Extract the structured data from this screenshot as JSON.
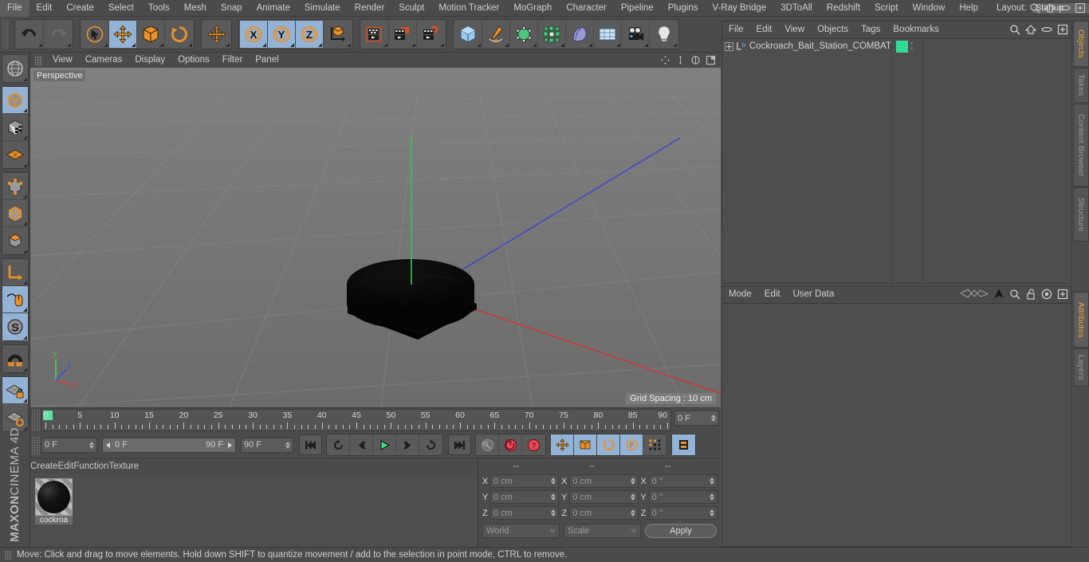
{
  "app": {
    "name": "MAXON CINEMA 4D",
    "brand_bold": "MAXON",
    "brand_rest": "CINEMA 4D"
  },
  "menubar": {
    "items": [
      {
        "label": "File"
      },
      {
        "label": "Edit"
      },
      {
        "label": "Create"
      },
      {
        "label": "Select"
      },
      {
        "label": "Tools"
      },
      {
        "label": "Mesh"
      },
      {
        "label": "Snap"
      },
      {
        "label": "Animate"
      },
      {
        "label": "Simulate"
      },
      {
        "label": "Render"
      },
      {
        "label": "Sculpt"
      },
      {
        "label": "Motion Tracker"
      },
      {
        "label": "MoGraph"
      },
      {
        "label": "Character"
      },
      {
        "label": "Pipeline"
      },
      {
        "label": "Plugins"
      },
      {
        "label": "V-Ray Bridge"
      },
      {
        "label": "3DToAll"
      },
      {
        "label": "Redshift"
      },
      {
        "label": "Script"
      },
      {
        "label": "Window"
      },
      {
        "label": "Help"
      }
    ],
    "layout_label": "Layout:",
    "layout_value": "Startup"
  },
  "toolbar": {
    "groups": [
      {
        "name": "history",
        "buttons": [
          {
            "name": "undo-button",
            "icon": "undo-icon",
            "active": false
          },
          {
            "name": "redo-button",
            "icon": "redo-icon",
            "active": false
          }
        ]
      },
      {
        "name": "transform-tools",
        "buttons": [
          {
            "name": "live-selection-tool",
            "icon": "cursor-select-icon",
            "active": false
          },
          {
            "name": "move-tool",
            "icon": "move-arrows-icon",
            "active": true
          },
          {
            "name": "scale-tool",
            "icon": "scale-box-icon",
            "active": false
          },
          {
            "name": "rotate-tool",
            "icon": "rotate-circle-icon",
            "active": false
          }
        ]
      },
      {
        "name": "world-move",
        "buttons": [
          {
            "name": "world-move-tool",
            "icon": "move-arrows-icon",
            "active": false
          }
        ]
      },
      {
        "name": "axis-locks",
        "buttons": [
          {
            "name": "lock-x-axis",
            "icon": "x-axis-icon",
            "active": true
          },
          {
            "name": "lock-y-axis",
            "icon": "y-axis-icon",
            "active": true
          },
          {
            "name": "lock-z-axis",
            "icon": "z-axis-icon",
            "active": true
          },
          {
            "name": "world-object-coordinates",
            "icon": "world-axis-cube-icon",
            "active": false
          }
        ]
      },
      {
        "name": "render-group",
        "buttons": [
          {
            "name": "render-view-button",
            "icon": "render-view-icon",
            "active": false
          },
          {
            "name": "render-region-button",
            "icon": "render-region-icon",
            "active": false
          },
          {
            "name": "render-settings-button",
            "icon": "render-settings-gear-icon",
            "active": false
          }
        ]
      },
      {
        "name": "object-creation",
        "buttons": [
          {
            "name": "add-cube-button",
            "icon": "cube-icon",
            "active": false
          },
          {
            "name": "add-spline-button",
            "icon": "pen-spline-icon",
            "active": false
          },
          {
            "name": "add-generator-button",
            "icon": "generator-cube-icon",
            "active": false
          },
          {
            "name": "add-deformer-button",
            "icon": "deformer-icon",
            "active": false
          },
          {
            "name": "add-scene-object-button",
            "icon": "bend-plane-icon",
            "active": false
          },
          {
            "name": "add-environment-button",
            "icon": "floor-grid-icon",
            "active": false
          },
          {
            "name": "add-camera-button",
            "icon": "camera-icon",
            "active": false
          },
          {
            "name": "add-light-button",
            "icon": "light-bulb-icon",
            "active": false
          }
        ]
      }
    ]
  },
  "left_palette": {
    "groups": [
      {
        "buttons": [
          {
            "name": "make-editable-button",
            "icon": "globe-wire-icon",
            "active": false
          }
        ]
      },
      {
        "buttons": [
          {
            "name": "model-mode-button",
            "icon": "model-cube-icon",
            "active": true
          },
          {
            "name": "texture-mode-button",
            "icon": "texture-cube-icon",
            "active": false
          },
          {
            "name": "workplane-mode-button",
            "icon": "workplane-grid-icon",
            "active": false
          }
        ]
      },
      {
        "buttons": [
          {
            "name": "points-mode-button",
            "icon": "points-cube-icon",
            "active": false
          },
          {
            "name": "edges-mode-button",
            "icon": "edges-cube-icon",
            "active": false
          },
          {
            "name": "polygons-mode-button",
            "icon": "polygons-cube-icon",
            "active": false
          }
        ]
      },
      {
        "buttons": [
          {
            "name": "object-axis-mode-button",
            "icon": "axis-l-icon",
            "active": false
          },
          {
            "name": "viewport-solo-button",
            "icon": "mouse-icon",
            "active": true
          },
          {
            "name": "enable-snapping-button",
            "icon": "s-snap-icon",
            "active": true
          }
        ]
      },
      {
        "buttons": [
          {
            "name": "magnet-tool-button",
            "icon": "magnet-icon",
            "active": false
          }
        ]
      },
      {
        "buttons": [
          {
            "name": "lock-workplane-button",
            "icon": "workplane-lock-icon",
            "active": true
          },
          {
            "name": "planar-workplane-button",
            "icon": "workplane-rotate-icon",
            "active": false
          }
        ]
      }
    ]
  },
  "viewport": {
    "menu": [
      {
        "label": "View"
      },
      {
        "label": "Cameras"
      },
      {
        "label": "Display"
      },
      {
        "label": "Options"
      },
      {
        "label": "Filter"
      },
      {
        "label": "Panel"
      }
    ],
    "label": "Perspective",
    "grid_spacing": "Grid Spacing : 10 cm",
    "nav_icons": [
      {
        "name": "viewport-pan-icon"
      },
      {
        "name": "viewport-zoom-icon"
      },
      {
        "name": "viewport-rotate-icon"
      },
      {
        "name": "viewport-maximize-icon"
      }
    ],
    "axis_gizmo": {
      "x": "X",
      "y": "Y",
      "z": "Z",
      "x_color": "#d83b3b",
      "y_color": "#3bd84a",
      "z_color": "#3b53d8"
    },
    "object_color": "#0b0b0b"
  },
  "timeline": {
    "ticks": [
      0,
      5,
      10,
      15,
      20,
      25,
      30,
      35,
      40,
      45,
      50,
      55,
      60,
      65,
      70,
      75,
      80,
      85,
      90
    ],
    "max_frame": 90,
    "current_frame_field": "0 F",
    "preview_min": "0 F",
    "preview_max": "90 F",
    "end_frame_field": "90 F",
    "right_frame_field": "0 F",
    "transport": [
      {
        "name": "go-to-start-button",
        "icon": "skip-start-icon"
      },
      {
        "name": "play-backwards-loop-button",
        "icon": "loop-back-icon"
      },
      {
        "name": "step-back-button",
        "icon": "step-back-icon"
      },
      {
        "name": "play-button",
        "icon": "play-icon"
      },
      {
        "name": "step-forward-button",
        "icon": "step-forward-icon"
      },
      {
        "name": "play-forward-loop-button",
        "icon": "loop-forward-icon"
      },
      {
        "name": "go-to-end-button",
        "icon": "skip-end-icon"
      }
    ],
    "keys": [
      {
        "name": "record-active-objects-button",
        "icon": "key-icon",
        "active": false
      },
      {
        "name": "autokeying-button",
        "icon": "auto-key-icon",
        "active": false
      },
      {
        "name": "keyframe-selection-button",
        "icon": "question-key-icon",
        "active": false
      }
    ],
    "key_filters": [
      {
        "name": "key-position-button",
        "icon": "move-arrows-icon",
        "active": true
      },
      {
        "name": "key-scale-button",
        "icon": "scale-box-icon",
        "active": true
      },
      {
        "name": "key-rotation-button",
        "icon": "rotate-circle-icon",
        "active": true
      },
      {
        "name": "key-parameter-button",
        "icon": "p-param-icon",
        "active": true
      },
      {
        "name": "key-point-level-button",
        "icon": "pla-dots-icon",
        "active": false
      }
    ],
    "extra": [
      {
        "name": "timeline-filmstrip-button",
        "icon": "filmstrip-icon",
        "active": true
      }
    ]
  },
  "material_manager": {
    "menu": [
      {
        "label": "Create"
      },
      {
        "label": "Edit"
      },
      {
        "label": "Function"
      },
      {
        "label": "Texture"
      }
    ],
    "materials": [
      {
        "name": "cockroa",
        "color": "#0c0c0c"
      }
    ]
  },
  "coordinates": {
    "headers": [
      "--",
      "--",
      "--"
    ],
    "rows": [
      {
        "axis": "X",
        "position": "0 cm",
        "size": "0 cm",
        "rotation": "0 °"
      },
      {
        "axis": "Y",
        "position": "0 cm",
        "size": "0 cm",
        "rotation": "0 °"
      },
      {
        "axis": "Z",
        "position": "0 cm",
        "size": "0 cm",
        "rotation": "0 °"
      }
    ],
    "coord_system": "World",
    "size_mode": "Scale",
    "apply_label": "Apply"
  },
  "object_manager": {
    "menu": [
      {
        "label": "File"
      },
      {
        "label": "Edit"
      },
      {
        "label": "View"
      },
      {
        "label": "Objects"
      },
      {
        "label": "Tags"
      },
      {
        "label": "Bookmarks"
      }
    ],
    "icons": [
      {
        "name": "search-icon"
      },
      {
        "name": "home-icon"
      },
      {
        "name": "ellipse-icon"
      },
      {
        "name": "new-layer-icon"
      }
    ],
    "objects": [
      {
        "name": "Cockroach_Bait_Station_COMBAT",
        "type": "null-object",
        "layer_color": "#2fdc95",
        "expandable": true
      }
    ]
  },
  "attribute_manager": {
    "menu": [
      {
        "label": "Mode"
      },
      {
        "label": "Edit"
      },
      {
        "label": "User Data"
      }
    ],
    "icons": [
      {
        "name": "animation-curve-icon"
      },
      {
        "name": "arrow-up-icon"
      },
      {
        "name": "search-icon"
      },
      {
        "name": "lock-icon"
      },
      {
        "name": "target-icon"
      },
      {
        "name": "new-tab-icon"
      }
    ]
  },
  "right_tabs": {
    "top": [
      {
        "label": "Objects",
        "selected": true
      },
      {
        "label": "Takes",
        "selected": false
      },
      {
        "label": "Content Browser",
        "selected": false
      },
      {
        "label": "Structure",
        "selected": false
      }
    ],
    "bottom": [
      {
        "label": "Attributes",
        "selected": true
      },
      {
        "label": "Layers",
        "selected": false
      }
    ]
  },
  "statusbar": {
    "message": "Move: Click and drag to move elements. Hold down SHIFT to quantize movement / add to the selection in point mode, CTRL to remove."
  },
  "colors": {
    "panel_bg": "#4b4b4b",
    "active_blue": "#93b3d6",
    "accent_orange": "#e8a33d",
    "green_layer": "#2fdc95",
    "viewport_bg": "#757575"
  }
}
